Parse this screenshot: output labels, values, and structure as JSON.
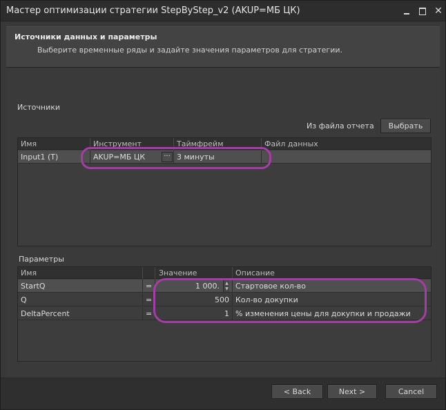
{
  "window": {
    "title": "Мастер оптимизации стратегии StepByStep_v2 (AKUP=МБ ЦК)"
  },
  "header": {
    "title": "Источники данных и параметры",
    "subtitle": "Выберите временные ряды и задайте значения параметров для стратегии."
  },
  "sources": {
    "label": "Источники",
    "from_file_label": "Из файла отчета",
    "choose_button": "Выбрать",
    "columns": [
      "Имя",
      "Инструмент",
      "Таймфрейм",
      "Файл данных"
    ],
    "rows": [
      {
        "name": "Input1 (T)",
        "instrument": "AKUP=МБ ЦК",
        "instrument_button": "···",
        "timeframe": "3 минуты",
        "file": ""
      }
    ]
  },
  "params": {
    "label": "Параметры",
    "columns": [
      "Имя",
      "",
      "Значение",
      "Описание"
    ],
    "rows": [
      {
        "name": "StartQ",
        "op": "=",
        "value": "1 000.",
        "description": "Стартовое кол-во"
      },
      {
        "name": "Q",
        "op": "=",
        "value": "500",
        "description": "Кол-во докупки"
      },
      {
        "name": "DeltaPercent",
        "op": "=",
        "value": "1",
        "description": "% изменения цены для докупки и продажи"
      }
    ]
  },
  "footer": {
    "back": "< Back",
    "next": "Next >",
    "cancel": "Cancel"
  },
  "colors": {
    "highlight": "#a63ca6",
    "selected_row": "#4f4f4f"
  }
}
